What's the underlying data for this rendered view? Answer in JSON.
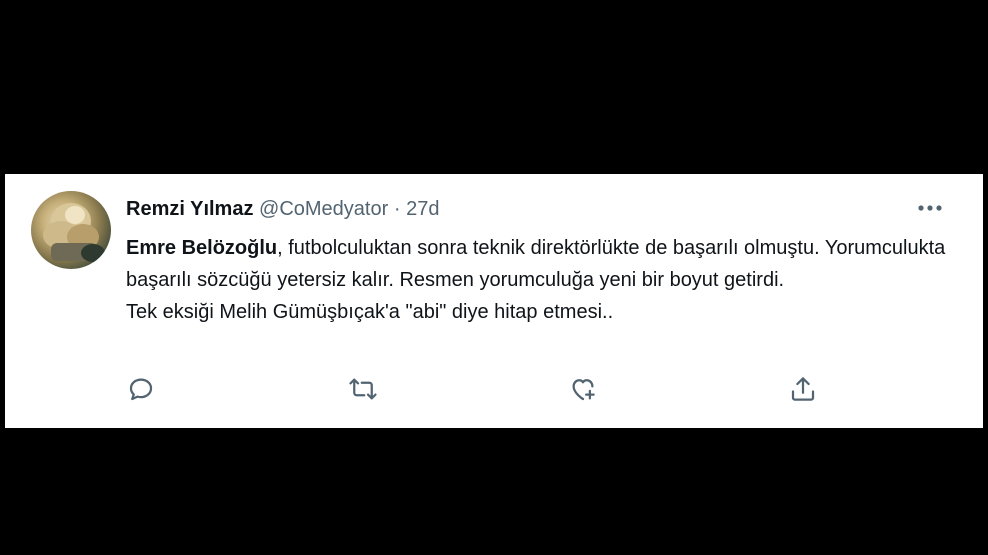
{
  "tweet": {
    "author": {
      "display_name": "Remzi Yılmaz",
      "handle": "@CoMedyator"
    },
    "separator": "·",
    "time": "27d",
    "body": {
      "mention_bold": "Emre Belözoğlu",
      "line1_rest": ", futbolculuktan sonra teknik direktörlükte de başarılı olmuştu. Yorumculukta başarılı sözcüğü yetersiz kalır. Resmen yorumculuğa yeni bir boyut getirdi.",
      "line2": "Tek eksiği Melih Gümüşbıçak'a \"abi\" diye hitap etmesi.."
    },
    "icons": {
      "more": "more-options-icon",
      "reply": "reply-icon",
      "retweet": "retweet-icon",
      "like": "like-icon",
      "share": "share-icon"
    },
    "colors": {
      "text": "#0f1419",
      "muted": "#536471",
      "background": "#ffffff",
      "frame": "#000000"
    }
  }
}
